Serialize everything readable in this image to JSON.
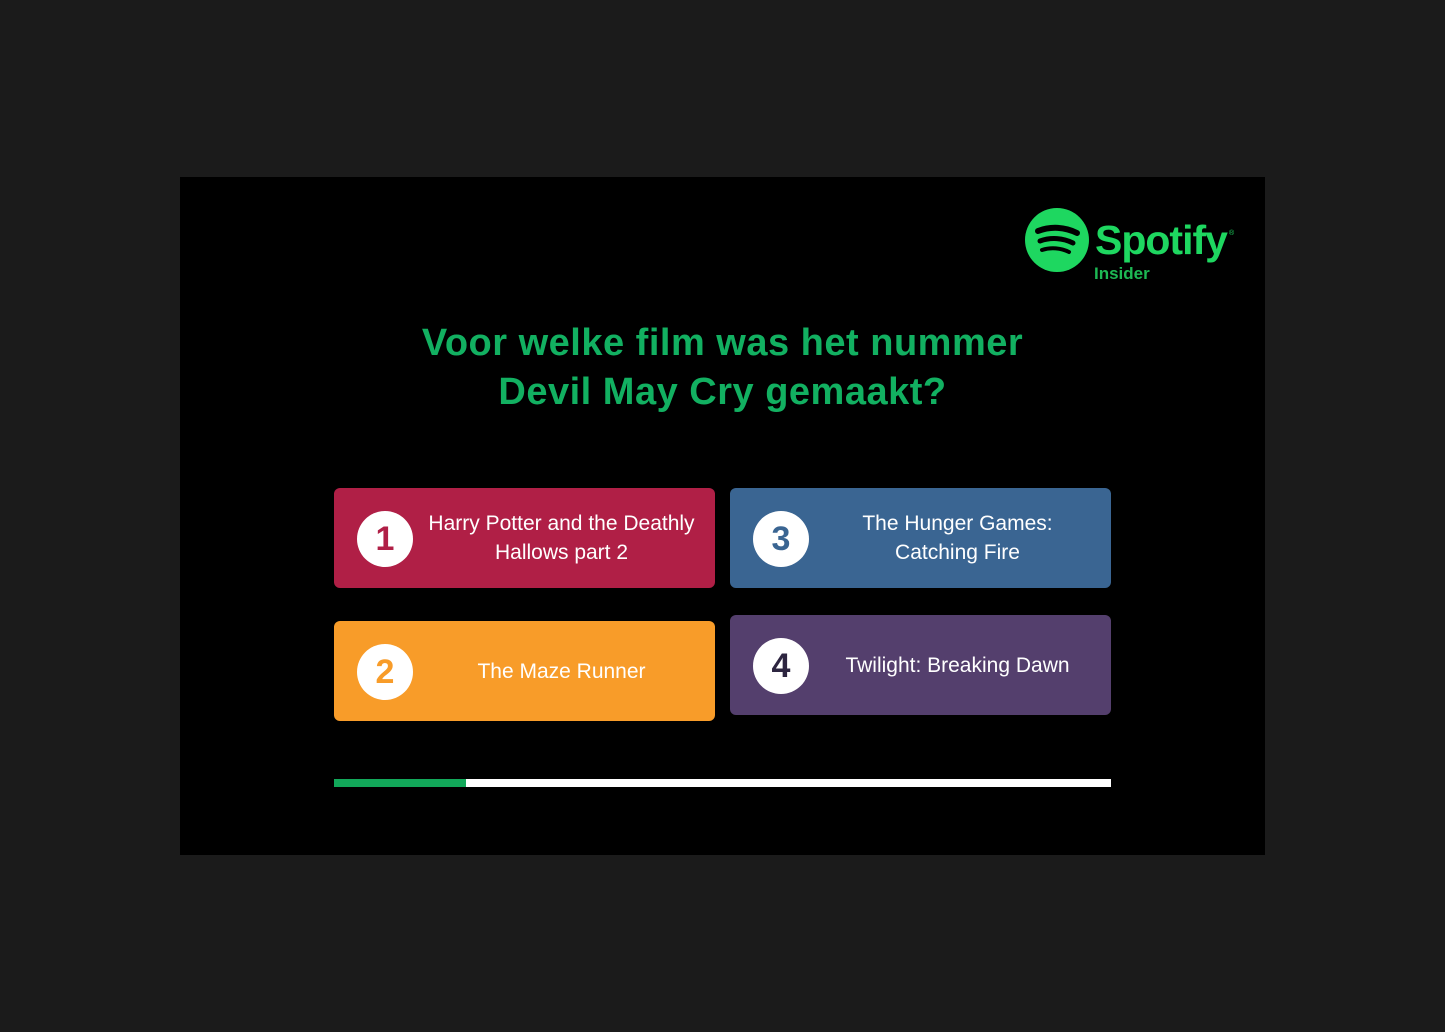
{
  "logo": {
    "wordmark": "Spotify",
    "registered": "®",
    "subtitle": "Insider",
    "icon": "spotify-logo-icon"
  },
  "question": {
    "line1": "Voor welke film was het nummer",
    "line2": "Devil May Cry gemaakt?"
  },
  "answers": [
    {
      "number": "1",
      "label": "Harry Potter and the Deathly Hallows part 2",
      "color": "#b01f46"
    },
    {
      "number": "2",
      "label": "The Maze Runner",
      "color": "#f89c29"
    },
    {
      "number": "3",
      "label": "The Hunger Games: Catching Fire",
      "color": "#3a6592"
    },
    {
      "number": "4",
      "label": "Twilight: Breaking Dawn",
      "color": "#543f6d"
    }
  ],
  "progress": {
    "fraction": 0.17,
    "fill_color": "#12a85a",
    "track_color": "#ffffff"
  },
  "colors": {
    "accent": "#12b061",
    "background": "#000000"
  }
}
